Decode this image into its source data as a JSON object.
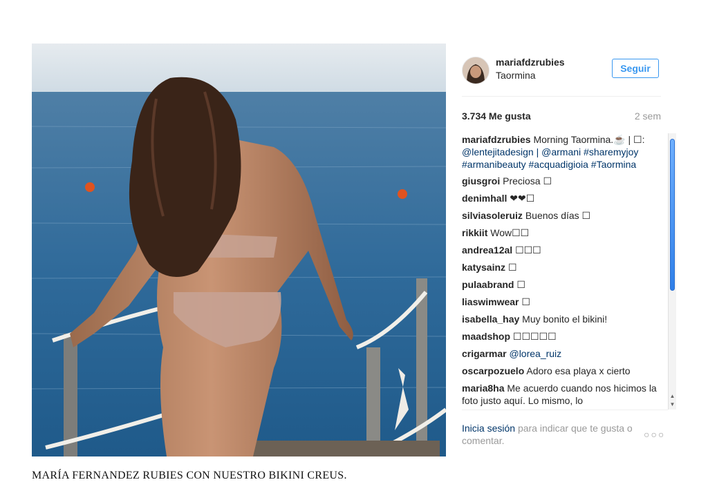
{
  "post": {
    "username": "mariafdzrubies",
    "location": "Taormina",
    "follow_label": "Seguir",
    "likes": "3.734 Me gusta",
    "time_ago": "2 sem",
    "caption_user": "mariafdzrubies",
    "caption_text": "Morning Taormina.☕ | ☐:",
    "caption_tags": "@lentejitadesign | @armani #sharemyjoy #armanibeauty #acquadigioia #Taormina",
    "comments": [
      {
        "user": "giusgroi",
        "text": "Preciosa ☐"
      },
      {
        "user": "denimhall",
        "text": "❤❤☐"
      },
      {
        "user": "silviasoleruiz",
        "text": "Buenos días ☐"
      },
      {
        "user": "rikkiit",
        "text": "Wow☐☐"
      },
      {
        "user": "andrea12al",
        "text": "☐☐☐"
      },
      {
        "user": "katysainz",
        "text": "☐"
      },
      {
        "user": "pulaabrand",
        "text": "☐"
      },
      {
        "user": "liaswimwear",
        "text": "☐"
      },
      {
        "user": "isabella_hay",
        "text": "Muy bonito el bikini!"
      },
      {
        "user": "maadshop",
        "text": "☐☐☐☐☐"
      },
      {
        "user": "crigarmar",
        "text": "@lorea_ruiz"
      },
      {
        "user": "oscarpozuelo",
        "text": "Adoro esa playa x cierto"
      },
      {
        "user": "maria8ha",
        "text": "Me acuerdo cuando nos hicimos la foto justo aquí. Lo mismo, lo"
      }
    ],
    "login_link": "Inicia sesión",
    "login_text": "para indicar que te gusta o comentar.",
    "more_label": "○○○"
  },
  "page_caption": "MARÍA FERNANDEZ RUBIES CON NUESTRO BIKINI CREUS.",
  "colors": {
    "accent": "#3897f0",
    "link": "#003569",
    "muted": "#999999",
    "text": "#262626"
  }
}
